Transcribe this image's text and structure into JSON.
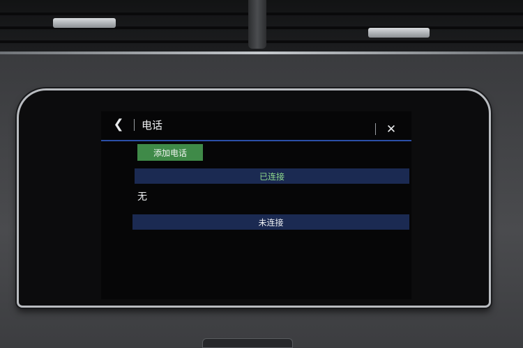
{
  "header": {
    "title": "电话",
    "back_icon": "chevron-left-icon",
    "close_icon": "close-icon"
  },
  "actions": {
    "add_phone_label": "添加电话"
  },
  "sections": {
    "connected": {
      "label": "已连接",
      "empty_text": "无"
    },
    "disconnected": {
      "label": "未连接"
    }
  },
  "colors": {
    "accent_line": "#2b4fa8",
    "add_button": "#3f8a48",
    "section_bar": "#1b2a52",
    "connected_text": "#8fd98c"
  }
}
